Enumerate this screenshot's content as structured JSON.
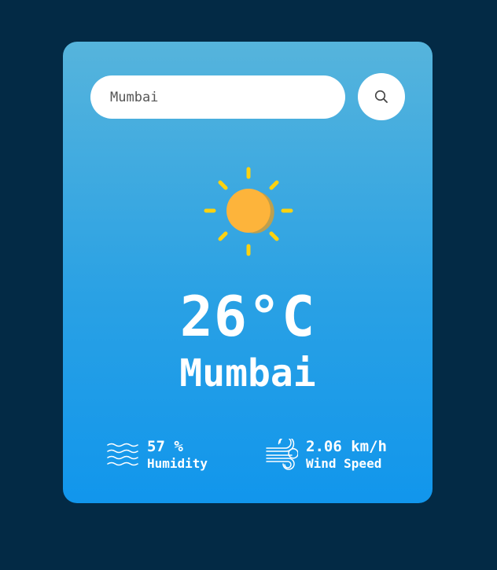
{
  "search": {
    "value": "Mumbai",
    "icon": "search-icon"
  },
  "weather": {
    "icon": "sun-icon",
    "temperature": "26°C",
    "city": "Mumbai"
  },
  "humidity": {
    "icon": "humidity-waves-icon",
    "value": "57 %",
    "label": "Humidity"
  },
  "wind": {
    "icon": "wind-icon",
    "value": "2.06 km/h",
    "label": "Wind Speed"
  },
  "colors": {
    "page_background": "#032a45",
    "card_gradient_top": "#56b4dc",
    "card_gradient_bottom": "#1196ec",
    "sun_core": "#fdb43b",
    "sun_rays": "#fcd20f"
  }
}
